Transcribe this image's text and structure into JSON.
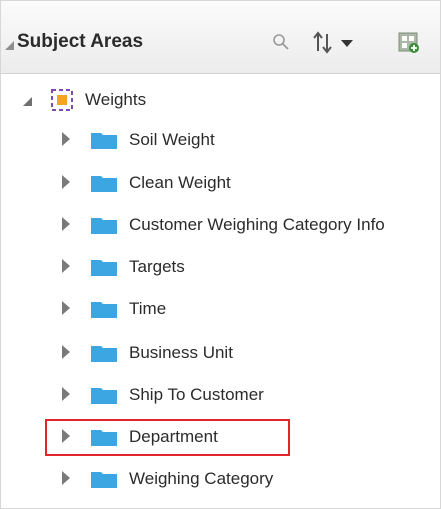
{
  "header": {
    "title": "Subject Areas",
    "icons": [
      "collapse-triangle-icon",
      "search-icon",
      "sort-icon",
      "chevron-down-icon",
      "add-subject-area-icon"
    ]
  },
  "tree": {
    "root": {
      "label": "Weights",
      "icon": "subject-area-icon",
      "expanded": true
    },
    "folders": [
      {
        "label": "Soil Weight"
      },
      {
        "label": "Clean Weight"
      },
      {
        "label": "Customer Weighing Category Info"
      },
      {
        "label": "Targets"
      },
      {
        "label": "Time"
      },
      {
        "label": "Business Unit"
      },
      {
        "label": "Ship To Customer"
      },
      {
        "label": "Department",
        "highlighted": true
      },
      {
        "label": "Weighing Category"
      }
    ]
  },
  "colors": {
    "folder_blue": "#3ba6e1",
    "highlight_red": "#e3262e",
    "subject_orange": "#f2a51e",
    "subject_purple": "#7d4bb3"
  }
}
